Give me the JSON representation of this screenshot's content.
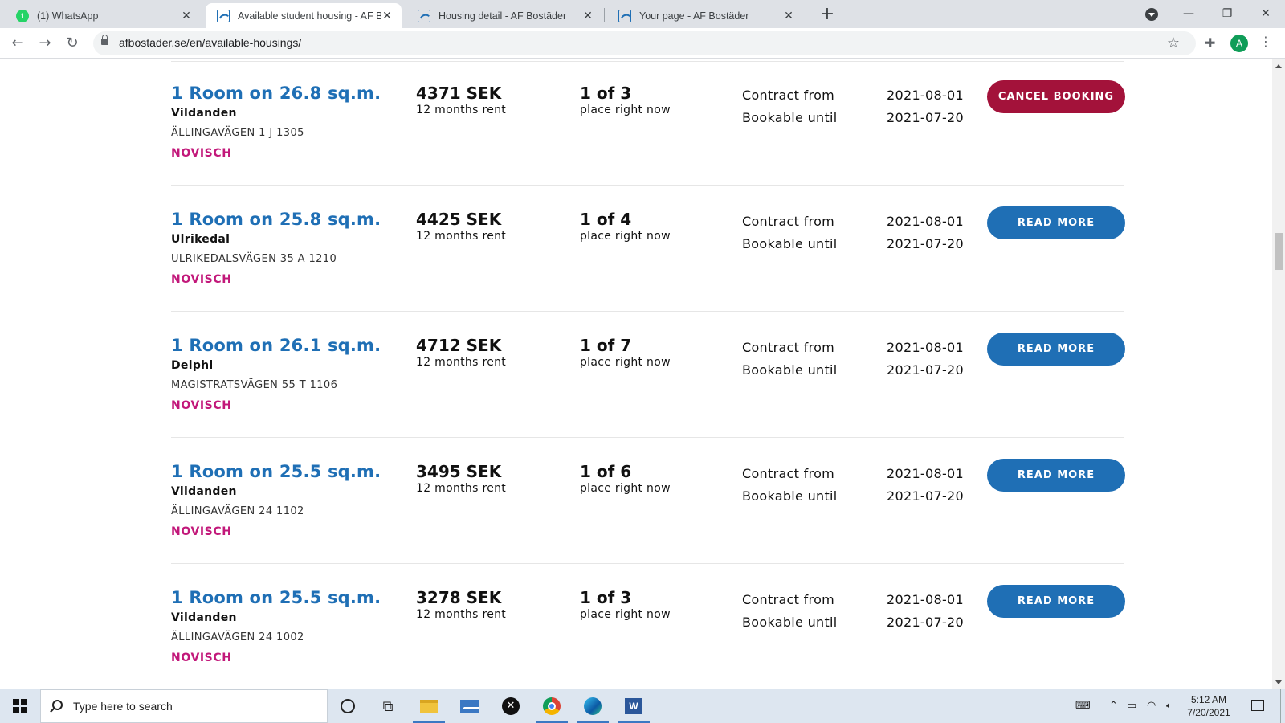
{
  "browser": {
    "tabs": [
      {
        "title": "(1) WhatsApp",
        "icon": "whatsapp-icon",
        "active": false
      },
      {
        "title": "Available student housing - AF Bostäder",
        "icon": "af-bostader-icon",
        "active": true
      },
      {
        "title": "Housing detail - AF Bostäder",
        "icon": "af-bostader-icon",
        "active": false
      },
      {
        "title": "Your page - AF Bostäder",
        "icon": "af-bostader-icon",
        "active": false
      }
    ],
    "whatsapp_badge": "1",
    "url": "afbostader.se/en/available-housings/",
    "profile_initial": "A"
  },
  "listings": [
    {
      "title": "1 Room on 26.8 sq.m.",
      "area": "Vildanden",
      "address": "ÄLLINGAVÄGEN 1 J 1305",
      "tag": "NOVISCH",
      "price": "4371 SEK",
      "price_note": "12 months rent",
      "place": "1 of 3",
      "place_note": "place right now",
      "contract_label": "Contract from",
      "contract_date": "2021-08-01",
      "bookable_label": "Bookable until",
      "bookable_date": "2021-07-20",
      "button": "CANCEL BOOKING",
      "button_style": "red"
    },
    {
      "title": "1 Room on 25.8 sq.m.",
      "area": "Ulrikedal",
      "address": "ULRIKEDALSVÄGEN 35 A 1210",
      "tag": "NOVISCH",
      "price": "4425 SEK",
      "price_note": "12 months rent",
      "place": "1 of 4",
      "place_note": "place right now",
      "contract_label": "Contract from",
      "contract_date": "2021-08-01",
      "bookable_label": "Bookable until",
      "bookable_date": "2021-07-20",
      "button": "READ MORE",
      "button_style": "blue"
    },
    {
      "title": "1 Room on 26.1 sq.m.",
      "area": "Delphi",
      "address": "MAGISTRATSVÄGEN 55 T 1106",
      "tag": "NOVISCH",
      "price": "4712 SEK",
      "price_note": "12 months rent",
      "place": "1 of 7",
      "place_note": "place right now",
      "contract_label": "Contract from",
      "contract_date": "2021-08-01",
      "bookable_label": "Bookable until",
      "bookable_date": "2021-07-20",
      "button": "READ MORE",
      "button_style": "blue"
    },
    {
      "title": "1 Room on 25.5 sq.m.",
      "area": "Vildanden",
      "address": "ÄLLINGAVÄGEN 24 1102",
      "tag": "NOVISCH",
      "price": "3495 SEK",
      "price_note": "12 months rent",
      "place": "1 of 6",
      "place_note": "place right now",
      "contract_label": "Contract from",
      "contract_date": "2021-08-01",
      "bookable_label": "Bookable until",
      "bookable_date": "2021-07-20",
      "button": "READ MORE",
      "button_style": "blue"
    },
    {
      "title": "1 Room on 25.5 sq.m.",
      "area": "Vildanden",
      "address": "ÄLLINGAVÄGEN 24 1002",
      "tag": "NOVISCH",
      "price": "3278 SEK",
      "price_note": "12 months rent",
      "place": "1 of 3",
      "place_note": "place right now",
      "contract_label": "Contract from",
      "contract_date": "2021-08-01",
      "bookable_label": "Bookable until",
      "bookable_date": "2021-07-20",
      "button": "READ MORE",
      "button_style": "blue"
    }
  ],
  "colors": {
    "link_blue": "#1f6fb5",
    "cancel_red": "#a3123a",
    "tag_magenta": "#c2187a"
  },
  "taskbar": {
    "search_placeholder": "Type here to search",
    "time": "5:12 AM",
    "date": "7/20/2021",
    "pinned": [
      "task-view-icon",
      "file-explorer-icon",
      "mail-icon",
      "xbox-icon",
      "chrome-icon",
      "edge-icon",
      "word-icon"
    ]
  }
}
